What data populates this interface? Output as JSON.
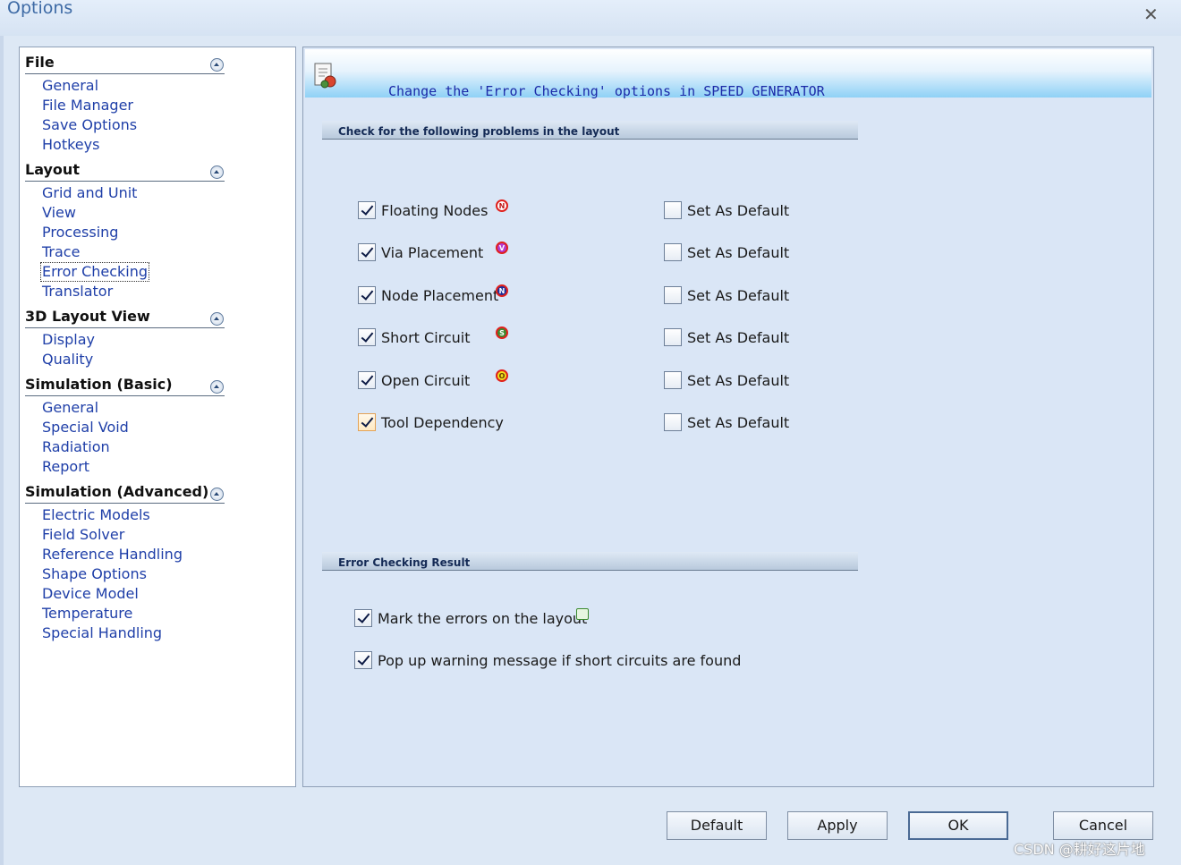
{
  "window": {
    "title": "Options"
  },
  "nav": {
    "groups": [
      {
        "title": "File",
        "items": [
          "General",
          "File Manager",
          "Save Options",
          "Hotkeys"
        ]
      },
      {
        "title": "Layout",
        "items": [
          "Grid and Unit",
          "View",
          "Processing",
          "Trace",
          "Error Checking",
          "Translator"
        ]
      },
      {
        "title": "3D Layout View",
        "items": [
          "Display",
          "Quality"
        ]
      },
      {
        "title": "Simulation (Basic)",
        "items": [
          "General",
          "Special Void",
          "Radiation",
          "Report"
        ]
      },
      {
        "title": "Simulation (Advanced)",
        "items": [
          "Electric Models",
          "Field Solver",
          "Reference Handling",
          "Shape Options",
          "Device Model",
          "Temperature",
          "Special Handling"
        ]
      }
    ],
    "selected": "Error Checking"
  },
  "banner": {
    "text": "Change the 'Error Checking' options in SPEED GENERATOR"
  },
  "check_section": {
    "title": "Check for the following problems in the layout",
    "rows": [
      {
        "label": "Floating Nodes",
        "checked": true,
        "icon": "floating-nodes-icon",
        "default_label": "Set As Default",
        "default_checked": false
      },
      {
        "label": "Via Placement",
        "checked": true,
        "icon": "via-placement-icon",
        "default_label": "Set As Default",
        "default_checked": false
      },
      {
        "label": "Node Placement",
        "checked": true,
        "icon": "node-placement-icon",
        "default_label": "Set As Default",
        "default_checked": false
      },
      {
        "label": "Short Circuit",
        "checked": true,
        "icon": "short-circuit-icon",
        "default_label": "Set As Default",
        "default_checked": false
      },
      {
        "label": "Open Circuit",
        "checked": true,
        "icon": "open-circuit-icon",
        "default_label": "Set As Default",
        "default_checked": false
      },
      {
        "label": "Tool Dependency",
        "checked": true,
        "icon": "",
        "default_label": "Set As Default",
        "default_checked": false
      }
    ]
  },
  "result_section": {
    "title": "Error Checking Result",
    "options": [
      {
        "label": "Mark the errors on the layout",
        "checked": true,
        "icon": "mark-errors-icon"
      },
      {
        "label": "Pop up warning message if short circuits are found",
        "checked": true,
        "icon": ""
      }
    ]
  },
  "buttons": {
    "default": "Default",
    "apply": "Apply",
    "ok": "OK",
    "cancel": "Cancel"
  },
  "watermark": "CSDN @耕好这片地",
  "colors": {
    "nav_link": "#1f3fa8",
    "banner_text": "#1c2aa8",
    "accent": "#8fd1f6"
  }
}
